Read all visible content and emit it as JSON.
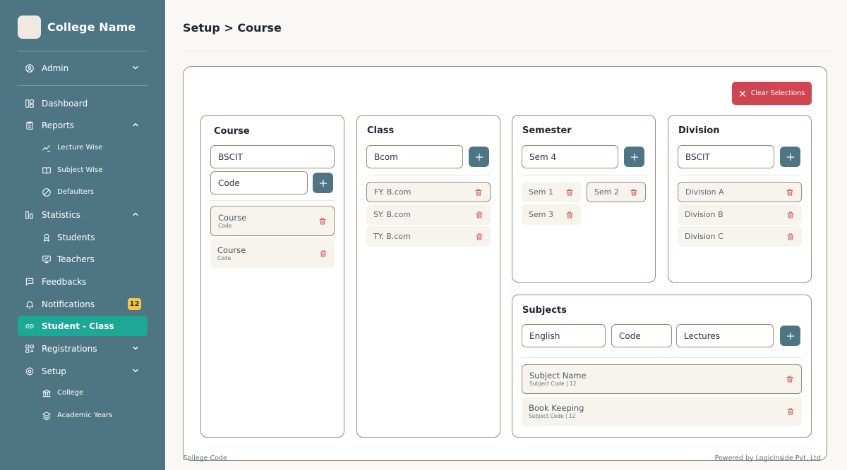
{
  "sidebar": {
    "brand": "College Name",
    "items": [
      {
        "label": "Admin"
      },
      {
        "label": "Dashboard"
      },
      {
        "label": "Reports"
      },
      {
        "label": "Lecture Wise"
      },
      {
        "label": "Subject Wise"
      },
      {
        "label": "Defaulters"
      },
      {
        "label": "Statistics"
      },
      {
        "label": "Students"
      },
      {
        "label": "Teachers"
      },
      {
        "label": "Feedbacks"
      },
      {
        "label": "Notifications",
        "badge": "12"
      },
      {
        "label": "Student - Class"
      },
      {
        "label": "Registrations"
      },
      {
        "label": "Setup"
      },
      {
        "label": "College"
      },
      {
        "label": "Academic Years"
      }
    ],
    "active_color": "#1ba894",
    "bg_color": "#4e7584"
  },
  "header": {
    "title": "Setup > Course"
  },
  "actions": {
    "clear_label": "Clear Selections",
    "clear_color": "#d0454f"
  },
  "course": {
    "title": "Course",
    "name_value": "BSCIT",
    "code_value": "Code",
    "items": [
      {
        "name": "Course",
        "sub": "Code"
      },
      {
        "name": "Course",
        "sub": "Code"
      }
    ]
  },
  "class": {
    "title": "Class",
    "value": "Bcom",
    "items": [
      "FY. B.com",
      "SY. B.com",
      "TY. B.com"
    ]
  },
  "semester": {
    "title": "Semester",
    "value": "Sem 4",
    "items": [
      "Sem 1",
      "Sem 2",
      "Sem 3"
    ]
  },
  "division": {
    "title": "Division",
    "value": "BSCIT",
    "items": [
      "Division A",
      "Division B",
      "Division C"
    ]
  },
  "subjects": {
    "title": "Subjects",
    "name_value": "English",
    "code_value": "Code",
    "lectures_value": "Lectures",
    "items": [
      {
        "name": "Subject Name",
        "sub": "Subject Code | 12"
      },
      {
        "name": "Book Keeping",
        "sub": "Subject Code | 12"
      }
    ]
  },
  "footer": {
    "left": "College Code",
    "right": "Powered by LogicInside Pvt. Ltd."
  }
}
